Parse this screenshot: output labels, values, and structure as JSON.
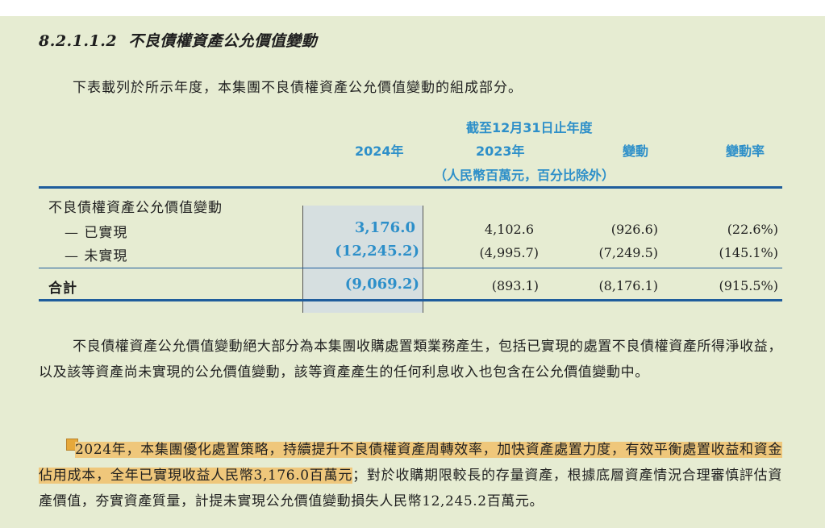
{
  "heading": {
    "number": "8.2.1.1.2",
    "title": "不良債權資產公允價值變動"
  },
  "intro": "下表載列於所示年度，本集團不良債權資產公允價值變動的組成部分。",
  "table": {
    "period_header": "截至12月31日止年度",
    "col_2024": "2024年",
    "col_2023": "2023年",
    "col_change": "變動",
    "col_rate": "變動率",
    "unit_note": "（人民幣百萬元，百分比除外）",
    "section_label": "不良債權資產公允價值變動",
    "rows": [
      {
        "label": "— 已實現",
        "v2024": "3,176.0",
        "v2023": "4,102.6",
        "change": "(926.6)",
        "rate": "(22.6%)"
      },
      {
        "label": "— 未實現",
        "v2024": "(12,245.2)",
        "v2023": "(4,995.7)",
        "change": "(7,249.5)",
        "rate": "(145.1%)"
      }
    ],
    "total": {
      "label": "合計",
      "v2024": "(9,069.2)",
      "v2023": "(893.1)",
      "change": "(8,176.1)",
      "rate": "(915.5%)"
    }
  },
  "para1": "不良債權資產公允價值變動絕大部分為本集團收購處置類業務產生，包括已實現的處置不良債權資產所得淨收益，以及該等資產尚未實現的公允價值變動，該等資產產生的任何利息收入也包含在公允價值變動中。",
  "para2": {
    "highlighted": "2024年，本集團優化處置策略，持續提升不良債權資產周轉效率，加快資產處置力度，有效平衡處置收益和資金佔用成本，全年已實現收益人民幣3,176.0百萬元",
    "rest": "；對於收購期限較長的存量資產，根據底層資產情況合理審慎評估資產價值，夯實資產質量，計提未實現公允價值變動損失人民幣12,245.2百萬元。"
  },
  "colors": {
    "accent_blue": "#2d8fc9",
    "rule_blue": "#1f5d9c",
    "page_bg": "#e6ecd2",
    "highlight": "#efc77b"
  }
}
